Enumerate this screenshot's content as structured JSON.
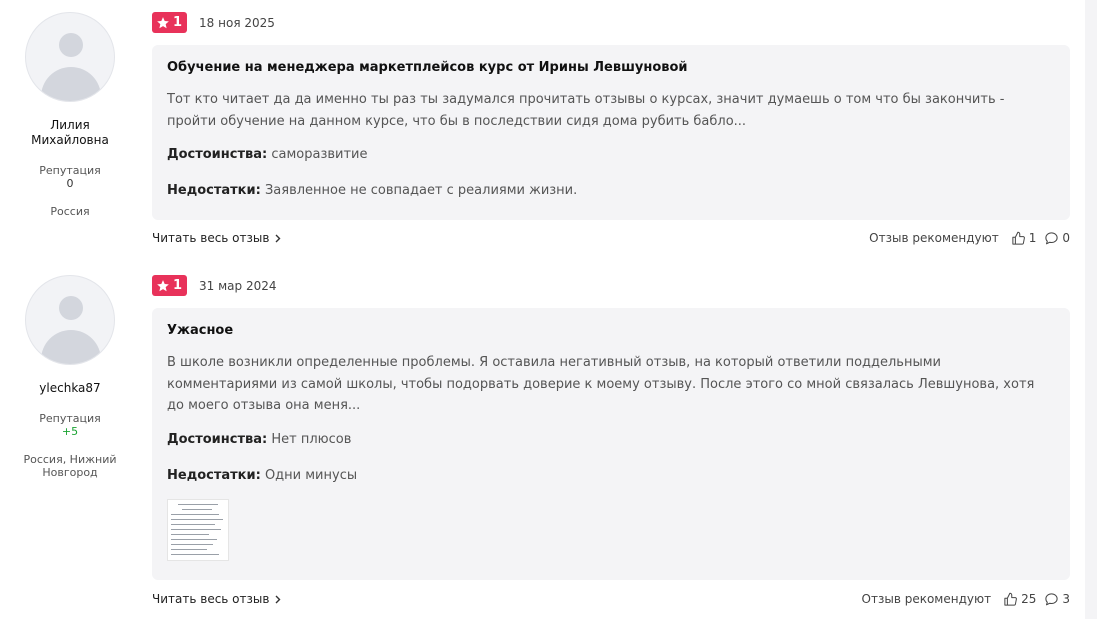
{
  "reviews": [
    {
      "author": {
        "name": "Лилия Михайловна",
        "reputation_label": "Репутация",
        "reputation": "0",
        "location": "Россия"
      },
      "rating": "1",
      "date": "18 ноя 2025",
      "title": "Обучение на менеджера маркетплейсов курс от Ирины Левшуновой",
      "text": "Тот кто читает да да именно ты раз ты задумался прочитать отзывы о курсах, значит думаешь о том что бы закончить - пройти обучение на данном курсе, что бы в последствии сидя дома рубить бабло...",
      "pros_label": "Достоинства:",
      "pros": "саморазвитие",
      "cons_label": "Недостатки:",
      "cons": "Заявленное не совпадает с реалиями жизни.",
      "read_more": "Читать весь отзыв",
      "recommend_label": "Отзыв рекомендуют",
      "likes": "1",
      "comments": "0"
    },
    {
      "author": {
        "name": "ylechka87",
        "reputation_label": "Репутация",
        "reputation": "+5",
        "location": "Россия, Нижний Новгород"
      },
      "rating": "1",
      "date": "31 мар 2024",
      "title": "Ужасное",
      "text": "В школе возникли определенные проблемы. Я оставила негативный отзыв, на который ответили поддельными комментариями из самой школы, чтобы подорвать доверие к моему отзыву. После этого со мной связалась Левшунова, хотя до моего отзыва она меня...",
      "pros_label": "Достоинства:",
      "pros": "Нет плюсов",
      "cons_label": "Недостатки:",
      "cons": "Одни минусы",
      "read_more": "Читать весь отзыв",
      "recommend_label": "Отзыв рекомендуют",
      "likes": "25",
      "comments": "3"
    }
  ],
  "colors": {
    "rating_badge": "#e8325a",
    "card_bg": "#f4f4f6",
    "positive_rep": "#1aa332"
  },
  "icons": [
    "star-icon",
    "chevron-right-icon",
    "thumbs-up-icon",
    "comment-icon",
    "user-avatar-icon"
  ]
}
